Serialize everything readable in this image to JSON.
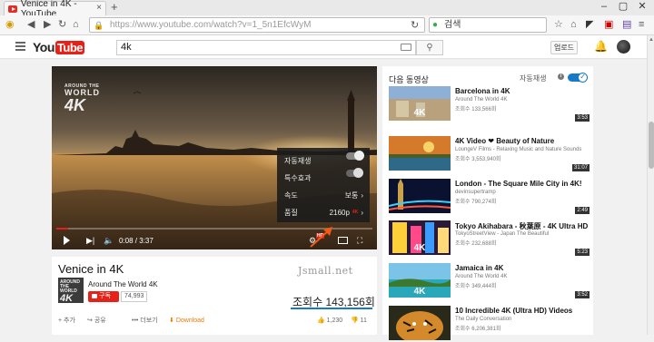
{
  "browser": {
    "tab_title": "Venice in 4K - YouTube",
    "tab_close": "×",
    "new_tab": "+",
    "url": "https://www.youtube.com/watch?v=1_5n1EfcWyM",
    "search_engine_text": "검색",
    "win_min": "–",
    "win_max": "▢",
    "win_close": "✕"
  },
  "youtube": {
    "logo_you": "You",
    "logo_tube": "Tube",
    "search_query": "4k",
    "upload_label": "업로드"
  },
  "player": {
    "watermark_small": "AROUND THE",
    "watermark_world": "WORLD",
    "watermark_4k": "4K",
    "time": "0:08 / 3:37",
    "progress_fraction": 0.037,
    "hd_badge": "HD",
    "settings_menu": {
      "items": [
        {
          "label": "자동재생",
          "type": "toggle",
          "on": true
        },
        {
          "label": "특수효과",
          "type": "toggle",
          "on": false
        },
        {
          "label": "속도",
          "value": "보통"
        },
        {
          "label": "품질",
          "value": "2160p",
          "badge": "4K"
        }
      ]
    }
  },
  "video": {
    "title": "Venice in 4K",
    "channel_thumb_small": "AROUND THE WORLD",
    "channel_thumb_big": "4K",
    "channel": "Around The World 4K",
    "subscribe_label": "구독",
    "subscriber_count": "74,993",
    "watermark_text": "Jsmall.net",
    "views": "조회수 143,156회",
    "actions": {
      "add": "+ 추가",
      "share": "공유",
      "more": "••• 더보기",
      "download": "Download",
      "likes": "1,230",
      "dislikes": "11"
    }
  },
  "sidebar": {
    "next_label": "다음 동영상",
    "autoplay_label": "자동재생",
    "recommendations": [
      {
        "title": "Barcelona in 4K",
        "channel": "Around The World 4K",
        "views": "조회수 133,566회",
        "duration": "3:53"
      },
      {
        "title": "4K Video ❤ Beauty of Nature",
        "channel": "LoungeV Films - Relaxing Music and Nature Sounds",
        "views": "조회수 3,553,940회",
        "duration": "31:07"
      },
      {
        "title": "London - The Square Mile City in 4K!",
        "channel": "devinsupertramp",
        "views": "조회수 790,274회",
        "duration": "2:49"
      },
      {
        "title": "Tokyo Akihabara - 秋葉原 - 4K Ultra HD",
        "channel": "TokyoStreetView - Japan The Beautiful",
        "views": "조회수 232,688회",
        "duration": "5:23"
      },
      {
        "title": "Jamaica in 4K",
        "channel": "Around The World 4K",
        "views": "조회수 349,444회",
        "duration": "3:52"
      },
      {
        "title": "10 Incredible 4K (Ultra HD) Videos",
        "channel": "The Daily Conversation",
        "views": "조회수 6,206,381회",
        "duration": ""
      }
    ]
  }
}
